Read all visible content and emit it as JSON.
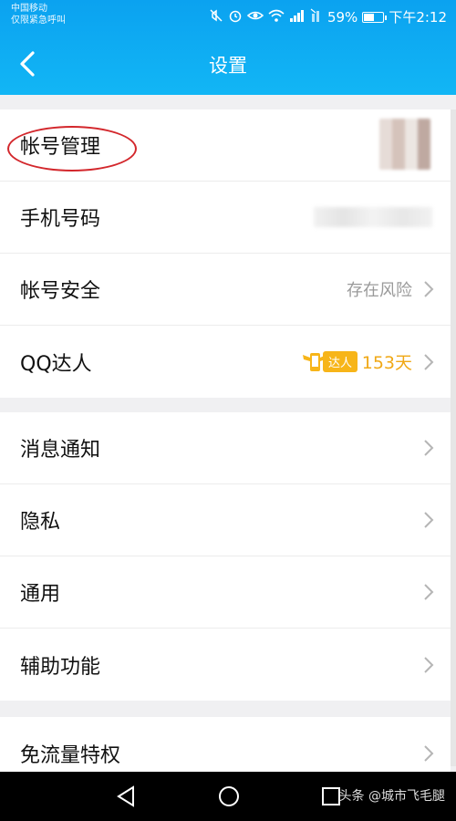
{
  "status_bar": {
    "carrier_line1": "中国移动",
    "carrier_line2": "仅限紧急呼叫",
    "battery_percent": "59%",
    "battery_level": 0.59,
    "time": "下午2:12"
  },
  "header": {
    "title": "设置"
  },
  "group1": [
    {
      "label": "帐号管理"
    },
    {
      "label": "手机号码"
    },
    {
      "label": "帐号安全",
      "value": "存在风险"
    },
    {
      "label": "QQ达人",
      "badge": "达人",
      "days": "153天"
    }
  ],
  "group2": [
    {
      "label": "消息通知"
    },
    {
      "label": "隐私"
    },
    {
      "label": "通用"
    },
    {
      "label": "辅助功能"
    }
  ],
  "group3": [
    {
      "label": "免流量特权"
    }
  ],
  "watermark": "头条 @城市飞毛腿",
  "colors": {
    "header": "#12b6f5",
    "annotation": "#d3272c",
    "qq_badge": "#f7b519"
  }
}
